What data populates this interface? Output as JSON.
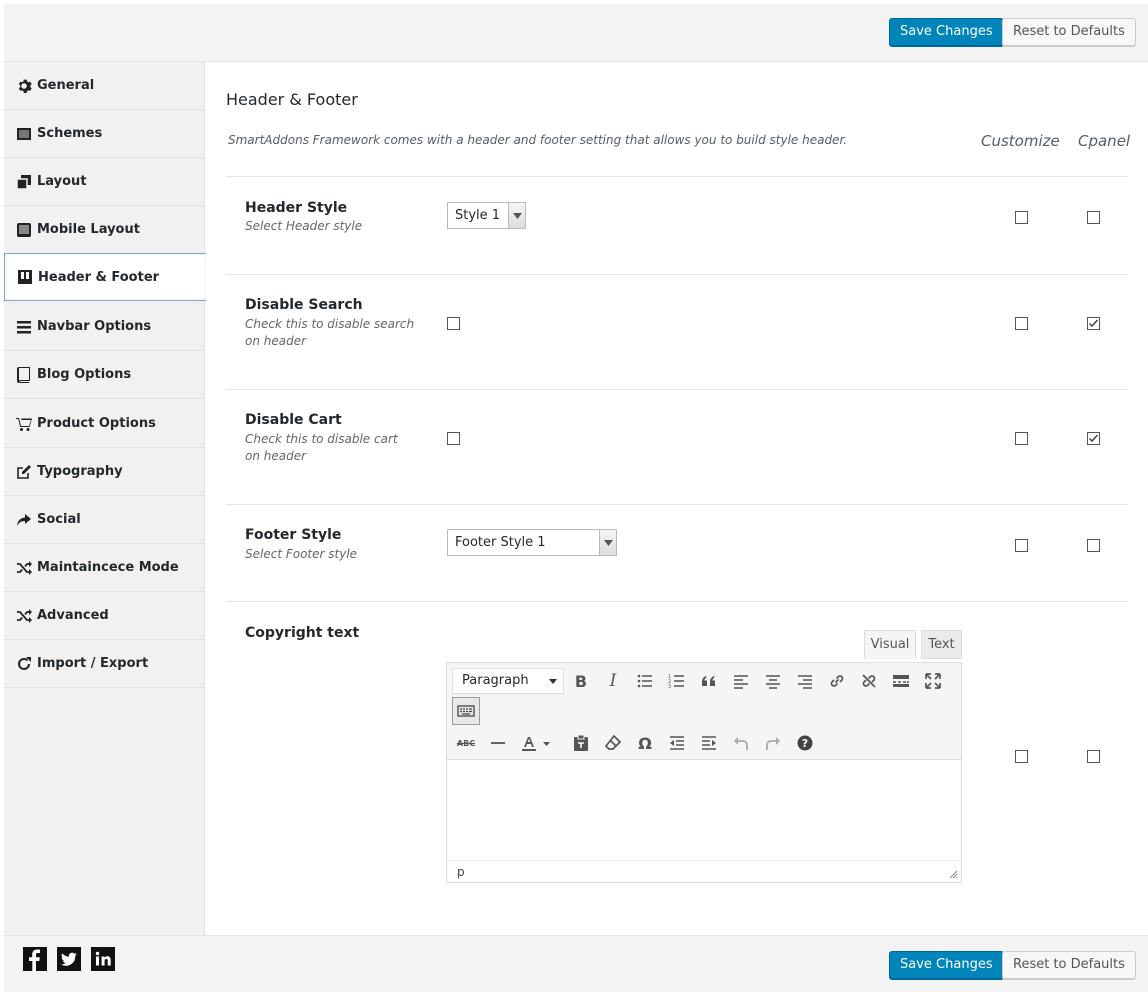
{
  "header_buttons": {
    "save": "Save Changes",
    "reset": "Reset to Defaults"
  },
  "footer_buttons": {
    "save": "Save Changes",
    "reset": "Reset to Defaults"
  },
  "sidebar": {
    "items": [
      {
        "label": "General",
        "icon": "gear-icon"
      },
      {
        "label": "Schemes",
        "icon": "schemes-icon"
      },
      {
        "label": "Layout",
        "icon": "layout-icon"
      },
      {
        "label": "Mobile Layout",
        "icon": "mobile-icon"
      },
      {
        "label": "Header & Footer",
        "icon": "header-footer-icon",
        "active": true
      },
      {
        "label": "Navbar Options",
        "icon": "menu-icon"
      },
      {
        "label": "Blog Options",
        "icon": "book-icon"
      },
      {
        "label": "Product Options",
        "icon": "cart-icon"
      },
      {
        "label": "Typography",
        "icon": "edit-icon"
      },
      {
        "label": "Social",
        "icon": "share-icon"
      },
      {
        "label": "Maintaincece Mode",
        "icon": "random-icon"
      },
      {
        "label": "Advanced",
        "icon": "random-icon"
      },
      {
        "label": "Import / Export",
        "icon": "refresh-icon"
      }
    ]
  },
  "section": {
    "title": "Header & Footer",
    "description": "SmartAddons Framework comes with a header and footer setting that allows you to build style header.",
    "col_customize": "Customize",
    "col_cpanel": "Cpanel"
  },
  "fields": {
    "header_style": {
      "label": "Header Style",
      "desc": "Select Header style",
      "value": "Style 1",
      "customize": false,
      "cpanel": false
    },
    "disable_search": {
      "label": "Disable Search",
      "desc": "Check this to disable search on header",
      "checked": false,
      "customize": false,
      "cpanel": true
    },
    "disable_cart": {
      "label": "Disable Cart",
      "desc": "Check this to disable cart on header",
      "checked": false,
      "customize": false,
      "cpanel": true
    },
    "footer_style": {
      "label": "Footer Style",
      "desc": "Select Footer style",
      "value": "Footer Style 1",
      "customize": false,
      "cpanel": false
    },
    "copyright": {
      "label": "Copyright text",
      "customize": false,
      "cpanel": false
    }
  },
  "editor": {
    "tab_visual": "Visual",
    "tab_text": "Text",
    "format": "Paragraph",
    "status_path": "p"
  },
  "social": [
    "facebook-icon",
    "twitter-icon",
    "linkedin-icon"
  ]
}
